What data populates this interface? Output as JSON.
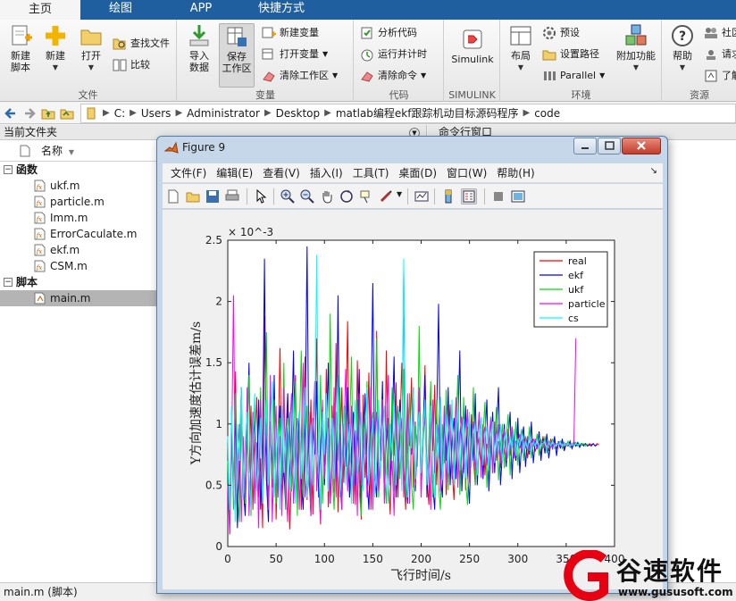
{
  "tabs": [
    {
      "label": "主页",
      "active": true
    },
    {
      "label": "绘图",
      "active": false
    },
    {
      "label": "APP",
      "active": false
    },
    {
      "label": "快捷方式",
      "active": false
    }
  ],
  "ribbon": {
    "file": {
      "label": "文件",
      "new_script": "新建\n脚本",
      "new": "新建",
      "open": "打开",
      "find_files": "查找文件",
      "compare": "比较"
    },
    "variable": {
      "label": "变量",
      "import": "导入\n数据",
      "save_workspace": "保存\n工作区",
      "new_variable": "新建变量",
      "open_variable": "打开变量",
      "clear_workspace": "清除工作区"
    },
    "code": {
      "label": "代码",
      "analyze": "分析代码",
      "run_time": "运行并计时",
      "clear_commands": "清除命令"
    },
    "simulink": {
      "label": "SIMULINK",
      "button": "Simulink"
    },
    "environment": {
      "label": "环境",
      "layout": "布局",
      "preferences": "预设",
      "set_path": "设置路径",
      "parallel": "Parallel",
      "addons": "附加功能"
    },
    "resources": {
      "label": "资源",
      "help": "帮助",
      "community": "社区",
      "request": "请求",
      "learn": "了解"
    }
  },
  "address": {
    "crumbs": [
      "C:",
      "Users",
      "Administrator",
      "Desktop",
      "matlab编程ekf跟踪机动目标源码程序",
      "code"
    ]
  },
  "filepanel": {
    "title": "当前文件夹",
    "column_name": "名称",
    "groups": [
      {
        "label": "函数",
        "files": [
          "ukf.m",
          "particle.m",
          "Imm.m",
          "ErrorCaculate.m",
          "ekf.m",
          "CSM.m"
        ]
      },
      {
        "label": "脚本",
        "files": [
          "main.m"
        ]
      }
    ],
    "selected_file": "main.m"
  },
  "command_window": {
    "title": "命令行窗口"
  },
  "status": {
    "text": "main.m  (脚本)"
  },
  "figure": {
    "title": "Figure 9",
    "menus": [
      "文件(F)",
      "编辑(E)",
      "查看(V)",
      "插入(I)",
      "工具(T)",
      "桌面(D)",
      "窗口(W)",
      "帮助(H)"
    ]
  },
  "watermark": {
    "brand": "谷速软件",
    "url": "www.gususoft.com"
  },
  "colors": {
    "tab_bar": "#1f5f9f",
    "real": "#ff0000",
    "ekf": "#0000ff",
    "ukf": "#00dd00",
    "particle": "#ff00ff",
    "cs": "#00ffff",
    "watermark_red": "#e60012"
  },
  "chart_data": {
    "type": "line",
    "title": "",
    "xlabel": "飞行时间/s",
    "ylabel": "Y方向加速度估计误差m/s",
    "xlim": [
      0,
      400
    ],
    "ylim": [
      0,
      2.5
    ],
    "y_exponent_label": "× 10^-3",
    "x_ticks": [
      0,
      50,
      100,
      150,
      200,
      250,
      300,
      350,
      400
    ],
    "x_tick_labels": [
      "0",
      "50",
      "100",
      "150",
      "200",
      "250",
      "300",
      "350",
      "400"
    ],
    "y_ticks": [
      0,
      0.5,
      1,
      1.5,
      2,
      2.5
    ],
    "y_tick_labels": [
      "0",
      "0.5",
      "1",
      "1.5",
      "2",
      "2.5"
    ],
    "grid": false,
    "legend_position": "top-right",
    "series": [
      {
        "name": "real",
        "color": "#ff0000",
        "x_step": 2,
        "values": [
          0.82,
          0.1,
          1.12,
          0.35,
          1.43,
          0.2,
          0.62,
          1.05,
          0.45,
          0.28,
          0.95,
          0.6,
          1.15,
          0.3,
          0.85,
          1.22,
          0.4,
          0.72,
          0.15,
          1.88,
          0.55,
          0.33,
          1.02,
          0.48,
          1.3,
          0.22,
          0.78,
          1.62,
          0.36,
          0.64,
          0.9,
          1.25,
          0.14,
          0.58,
          0.98,
          1.4,
          0.42,
          1.1,
          0.3,
          0.86,
          1.55,
          0.38,
          0.68,
          1.2,
          0.26,
          0.92,
          1.7,
          0.5,
          0.18,
          1.05,
          0.62,
          1.45,
          0.32,
          0.8,
          1.15,
          0.44,
          1.66,
          0.28,
          0.74,
          1.3,
          0.52,
          0.96,
          1.84,
          0.4,
          0.6,
          1.08,
          0.34,
          1.52,
          0.7,
          0.22,
          1.24,
          0.56,
          0.88,
          1.42,
          0.3,
          1.0,
          0.66,
          1.76,
          0.46,
          0.84,
          1.14,
          0.36,
          1.6,
          0.58,
          0.26,
          1.12,
          0.74,
          1.34,
          0.4,
          0.94,
          1.5,
          0.62,
          0.3,
          1.18,
          0.82,
          1.38,
          0.48,
          1.02,
          0.7,
          1.26,
          0.44,
          0.9,
          1.48,
          0.56,
          0.34,
          1.1,
          0.78,
          1.32,
          0.5,
          0.96,
          1.22,
          0.6,
          1.06,
          0.42,
          0.86,
          1.16,
          0.64,
          0.38,
          0.92,
          1.04,
          0.54,
          0.88,
          1.12,
          0.46,
          0.98,
          0.62,
          1.08,
          0.72,
          0.5,
          0.94,
          0.8,
          0.66,
          1.0,
          0.58,
          0.84,
          0.76,
          0.9,
          0.6,
          1.02,
          0.7,
          0.86,
          0.64,
          0.92,
          0.78,
          0.68,
          0.96,
          0.74,
          0.88,
          0.82,
          0.7,
          0.94,
          0.8,
          0.86,
          0.76,
          0.9,
          0.72,
          0.84,
          0.8,
          0.88,
          0.78,
          0.82,
          0.86,
          0.74,
          0.9,
          0.8,
          0.84,
          0.78,
          0.88,
          0.82,
          0.86,
          0.8,
          0.84,
          0.82,
          0.86,
          0.8,
          0.84,
          0.82,
          0.84,
          0.8,
          0.86,
          0.82,
          0.84,
          0.82,
          0.84,
          0.83,
          0.84,
          0.82,
          0.84,
          0.83,
          0.84,
          0.82,
          0.84,
          0.83
        ]
      },
      {
        "name": "ekf",
        "color": "#0000ff",
        "x_step": 2,
        "values": [
          0.6,
          0.2,
          0.95,
          0.4,
          1.1,
          0.15,
          0.7,
          1.3,
          0.5,
          0.25,
          0.9,
          1.5,
          0.35,
          0.8,
          1.05,
          0.45,
          1.2,
          0.3,
          0.75,
          2.35,
          0.55,
          0.2,
          1.0,
          0.6,
          1.4,
          0.35,
          0.85,
          1.15,
          0.45,
          0.65,
          0.3,
          1.25,
          0.5,
          0.9,
          1.6,
          0.4,
          0.7,
          1.1,
          0.55,
          0.3,
          0.95,
          2.45,
          0.6,
          0.25,
          1.05,
          0.75,
          1.35,
          0.4,
          0.85,
          1.15,
          0.5,
          0.95,
          1.5,
          0.35,
          0.7,
          1.2,
          0.45,
          2.05,
          0.55,
          0.3,
          1.0,
          0.65,
          1.3,
          0.4,
          0.8,
          1.1,
          0.5,
          0.9,
          1.45,
          0.35,
          0.75,
          1.25,
          0.55,
          0.3,
          1.0,
          2.15,
          0.6,
          0.4,
          1.15,
          0.7,
          1.35,
          0.45,
          0.85,
          1.05,
          0.5,
          0.95,
          1.55,
          0.4,
          0.7,
          1.2,
          0.5,
          2.25,
          0.6,
          0.35,
          1.05,
          0.75,
          1.3,
          0.45,
          0.9,
          1.1,
          0.55,
          0.95,
          1.4,
          0.4,
          0.8,
          1.2,
          0.5,
          0.3,
          1.0,
          1.98,
          0.6,
          0.4,
          1.1,
          0.7,
          1.3,
          0.5,
          0.85,
          1.05,
          0.55,
          0.95,
          1.6,
          0.45,
          0.75,
          1.15,
          0.6,
          0.35,
          1.0,
          0.7,
          1.25,
          0.5,
          0.85,
          1.05,
          0.55,
          0.9,
          1.2,
          0.45,
          0.8,
          1.1,
          0.6,
          0.95,
          1.3,
          0.5,
          0.75,
          1.0,
          0.65,
          0.88,
          1.1,
          0.55,
          0.92,
          0.7,
          1.05,
          0.6,
          0.85,
          0.98,
          0.65,
          0.9,
          0.75,
          1.02,
          0.68,
          0.86,
          0.8,
          0.94,
          0.7,
          0.88,
          0.76,
          0.92,
          0.72,
          0.84,
          0.8,
          0.9,
          0.74,
          0.86,
          0.8,
          0.88,
          0.78,
          0.84,
          0.82,
          0.86,
          0.8,
          0.84,
          0.82,
          0.85,
          0.81,
          0.84,
          0.82,
          0.84,
          0.82,
          0.83,
          0.82,
          0.84,
          0.82,
          0.83
        ]
      },
      {
        "name": "ukf",
        "color": "#00dd00",
        "x_step": 2,
        "values": [
          0.7,
          0.15,
          1.0,
          0.3,
          1.25,
          0.5,
          0.2,
          1.1,
          0.6,
          0.35,
          0.9,
          1.4,
          0.25,
          0.8,
          1.15,
          0.45,
          0.65,
          1.3,
          0.4,
          0.7,
          1.75,
          0.3,
          0.95,
          0.55,
          1.2,
          0.35,
          0.8,
          1.05,
          0.5,
          1.5,
          0.3,
          0.85,
          1.1,
          0.45,
          0.7,
          1.35,
          0.25,
          0.9,
          1.6,
          0.4,
          0.65,
          1.15,
          0.5,
          0.3,
          0.95,
          1.25,
          0.55,
          0.8,
          1.4,
          0.35,
          0.75,
          1.05,
          0.45,
          1.9,
          0.6,
          0.3,
          1.1,
          0.7,
          1.3,
          0.4,
          0.85,
          1.15,
          0.5,
          0.95,
          1.55,
          0.35,
          0.7,
          1.2,
          0.45,
          0.25,
          1.0,
          0.75,
          1.35,
          0.5,
          0.9,
          1.1,
          0.55,
          1.7,
          0.4,
          0.8,
          1.2,
          0.6,
          0.35,
          1.05,
          0.7,
          1.3,
          0.45,
          0.9,
          1.15,
          0.55,
          0.95,
          1.45,
          0.4,
          0.75,
          1.25,
          0.5,
          0.3,
          1.0,
          0.65,
          1.8,
          0.45,
          0.85,
          1.1,
          0.55,
          0.9,
          1.35,
          0.4,
          0.7,
          1.2,
          0.5,
          0.3,
          1.0,
          0.68,
          1.28,
          0.46,
          0.88,
          1.12,
          0.56,
          0.94,
          1.4,
          0.42,
          0.74,
          1.22,
          0.52,
          0.34,
          1.02,
          0.7,
          1.3,
          0.5,
          0.86,
          1.08,
          0.58,
          0.92,
          1.18,
          0.48,
          0.78,
          1.06,
          0.6,
          0.9,
          1.14,
          0.54,
          0.82,
          1.0,
          0.64,
          0.88,
          1.08,
          0.58,
          0.92,
          0.72,
          1.02,
          0.66,
          0.86,
          0.96,
          0.7,
          0.9,
          0.78,
          0.98,
          0.72,
          0.86,
          0.82,
          0.92,
          0.74,
          0.88,
          0.8,
          0.9,
          0.76,
          0.86,
          0.82,
          0.88,
          0.8,
          0.84,
          0.84,
          0.86,
          0.8,
          0.85,
          0.82,
          0.86,
          0.81,
          0.84,
          0.83,
          0.85,
          0.82,
          0.84,
          0.83,
          0.84,
          0.82,
          0.84
        ]
      },
      {
        "name": "particle",
        "color": "#ff00ff",
        "x_step": 2,
        "values": [
          0.5,
          0.1,
          0.8,
          2.05,
          0.3,
          0.6,
          1.0,
          0.2,
          0.9,
          0.4,
          1.3,
          0.25,
          0.7,
          1.1,
          0.35,
          0.85,
          0.15,
          1.2,
          0.45,
          0.65,
          1.0,
          0.3,
          1.4,
          0.2,
          0.75,
          1.15,
          0.4,
          0.9,
          0.25,
          1.3,
          0.55,
          0.2,
          0.95,
          1.25,
          0.35,
          0.7,
          1.05,
          0.3,
          0.85,
          1.5,
          0.4,
          0.6,
          1.1,
          0.25,
          0.9,
          1.35,
          0.45,
          0.75,
          0.2,
          1.2,
          0.55,
          0.85,
          1.05,
          0.35,
          0.65,
          1.3,
          0.4,
          0.8,
          1.0,
          0.3,
          0.9,
          1.45,
          0.45,
          0.7,
          1.15,
          0.35,
          0.95,
          0.25,
          1.25,
          0.5,
          0.8,
          1.05,
          0.4,
          0.65,
          1.3,
          0.3,
          0.9,
          1.1,
          0.45,
          0.75,
          1.2,
          0.35,
          0.95,
          1.4,
          0.5,
          0.7,
          0.25,
          1.15,
          0.6,
          0.85,
          1.05,
          0.4,
          0.7,
          1.25,
          0.35,
          0.9,
          1.1,
          0.5,
          0.75,
          1.3,
          0.4,
          0.95,
          1.05,
          0.55,
          0.8,
          0.3,
          1.2,
          0.6,
          0.85,
          1.0,
          0.45,
          0.7,
          1.15,
          0.5,
          0.9,
          1.05,
          0.55,
          0.78,
          1.22,
          0.48,
          0.92,
          1.06,
          0.6,
          0.82,
          1.12,
          0.52,
          0.88,
          1.02,
          0.62,
          0.84,
          1.1,
          0.56,
          0.9,
          0.98,
          0.66,
          0.86,
          1.04,
          0.6,
          0.92,
          0.74,
          1.0,
          0.68,
          0.88,
          0.96,
          0.7,
          0.9,
          0.78,
          0.98,
          0.72,
          0.86,
          0.84,
          0.92,
          0.76,
          0.88,
          0.8,
          0.9,
          0.78,
          0.86,
          0.82,
          0.88,
          0.8,
          0.84,
          0.84,
          0.86,
          0.8,
          0.85,
          0.82,
          0.86,
          0.81,
          0.84,
          0.83,
          0.85,
          0.82,
          0.84,
          0.83,
          0.84,
          0.82,
          0.84,
          0.82,
          0.84,
          1.7
        ]
      },
      {
        "name": "cs",
        "color": "#00ffff",
        "x_step": 2,
        "values": [
          0.9,
          0.3,
          1.15,
          0.5,
          0.2,
          1.0,
          0.7,
          1.3,
          0.4,
          0.85,
          1.1,
          0.55,
          0.3,
          0.95,
          1.25,
          0.45,
          0.75,
          1.05,
          0.35,
          0.8,
          1.2,
          0.5,
          0.9,
          1.35,
          0.4,
          0.7,
          1.0,
          0.3,
          1.15,
          0.6,
          0.85,
          1.05,
          0.45,
          0.75,
          1.25,
          0.35,
          0.95,
          1.1,
          0.55,
          0.8,
          1.3,
          0.4,
          0.7,
          1.0,
          0.5,
          0.9,
          2.38,
          0.6,
          0.3,
          1.1,
          0.75,
          1.25,
          0.45,
          0.85,
          1.05,
          0.55,
          0.95,
          1.4,
          0.4,
          0.7,
          1.15,
          0.5,
          0.8,
          1.0,
          0.35,
          0.9,
          1.2,
          0.6,
          0.75,
          1.1,
          0.45,
          0.95,
          1.3,
          0.5,
          0.8,
          1.05,
          0.4,
          0.7,
          1.2,
          0.55,
          0.9,
          1.15,
          0.6,
          0.35,
          1.0,
          0.75,
          1.25,
          0.5,
          0.85,
          1.1,
          0.45,
          2.35,
          0.65,
          0.4,
          1.05,
          0.8,
          1.3,
          0.55,
          0.9,
          1.1,
          0.6,
          0.95,
          1.2,
          0.5,
          0.8,
          1.15,
          0.6,
          0.4,
          1.0,
          0.72,
          1.22,
          0.54,
          0.88,
          1.08,
          0.6,
          0.94,
          1.2,
          0.5,
          0.8,
          1.12,
          0.62,
          0.9,
          1.04,
          0.56,
          0.86,
          1.1,
          0.64,
          0.92,
          1.0,
          0.58,
          0.84,
          1.06,
          0.66,
          0.9,
          0.98,
          0.62,
          0.88,
          1.02,
          0.68,
          0.92,
          0.76,
          1.0,
          0.7,
          0.86,
          0.94,
          0.72,
          0.9,
          0.8,
          0.96,
          0.74,
          0.88,
          0.82,
          0.92,
          0.76,
          0.86,
          0.8,
          0.9,
          0.78,
          0.86,
          0.82,
          0.88,
          0.8,
          0.84,
          0.84,
          0.86,
          0.8,
          0.85,
          0.82,
          0.86,
          0.81,
          0.84,
          0.83,
          0.85,
          0.82,
          0.84,
          0.83,
          0.84,
          0.82,
          0.84,
          0.82,
          0.84,
          0.83,
          0.84
        ]
      }
    ]
  }
}
